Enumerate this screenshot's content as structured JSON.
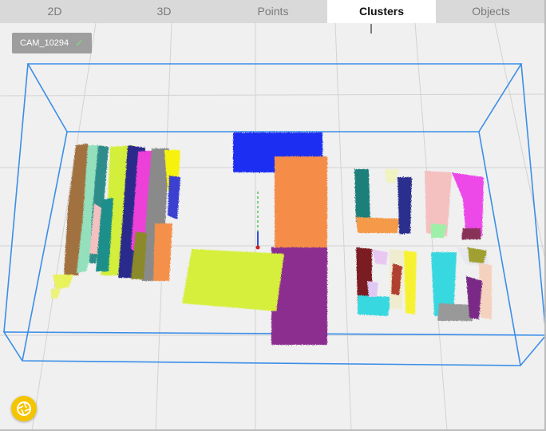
{
  "tabs": [
    {
      "label": "2D",
      "active": false
    },
    {
      "label": "3D",
      "active": false
    },
    {
      "label": "Points",
      "active": false
    },
    {
      "label": "Clusters",
      "active": true
    },
    {
      "label": "Objects",
      "active": false
    }
  ],
  "camera_badge": {
    "label": "CAM_10294",
    "status_icon": "check-icon"
  },
  "fab": {
    "icon": "camera-shutter-icon"
  },
  "colors": {
    "bbox": "#3b8ee8",
    "grid": "#d2d2d2",
    "tab_bar": "#d9d9d9",
    "fab": "#f5c400"
  }
}
